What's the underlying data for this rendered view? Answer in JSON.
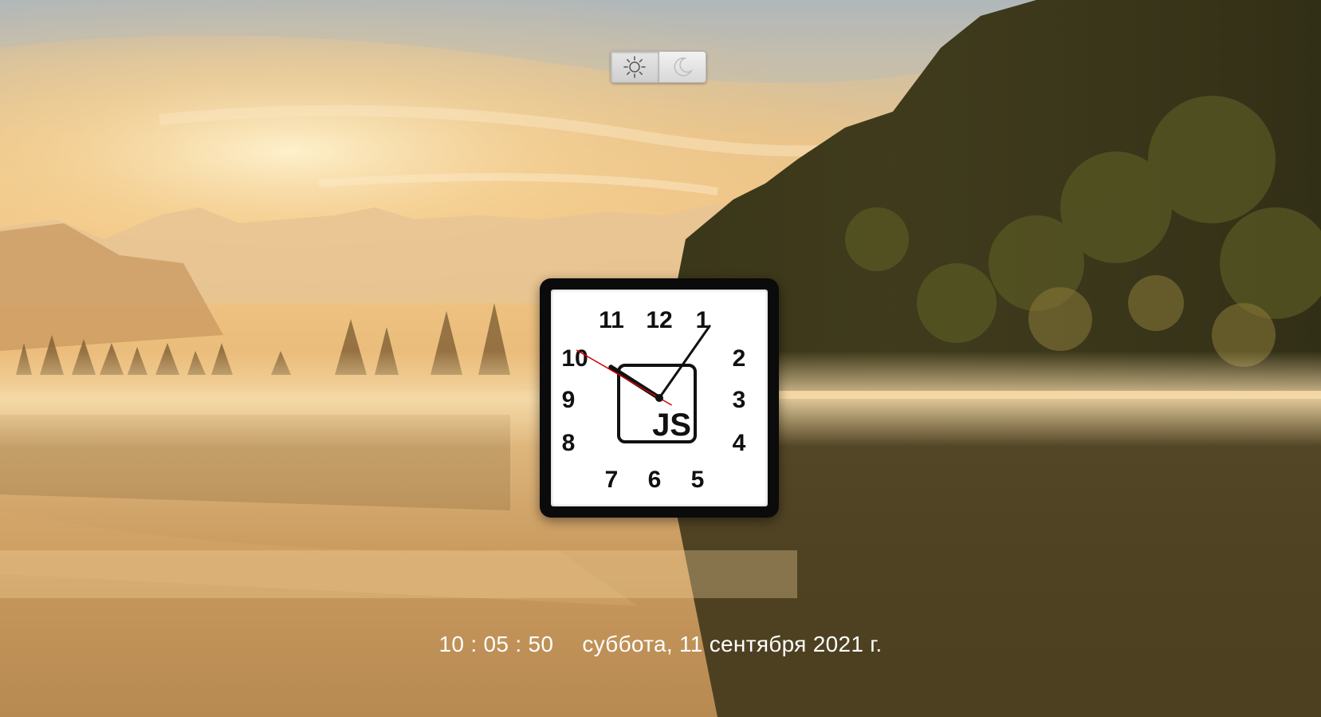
{
  "theme_toggle": {
    "options": [
      {
        "icon": "sun-icon",
        "active": true
      },
      {
        "icon": "moon-icon",
        "active": false
      }
    ]
  },
  "clock": {
    "numerals": [
      "12",
      "1",
      "2",
      "3",
      "4",
      "5",
      "6",
      "7",
      "8",
      "9",
      "10",
      "11"
    ],
    "logo_text": "JS",
    "hands": {
      "hours": 10,
      "minutes": 5,
      "seconds": 50
    },
    "colors": {
      "frame": "#0b0b0b",
      "face": "#ffffff",
      "hand": "#111111",
      "second_hand": "#d40000"
    }
  },
  "footer": {
    "time": "10 : 05 : 50",
    "date": "суббота, 11 сентября 2021 г."
  }
}
